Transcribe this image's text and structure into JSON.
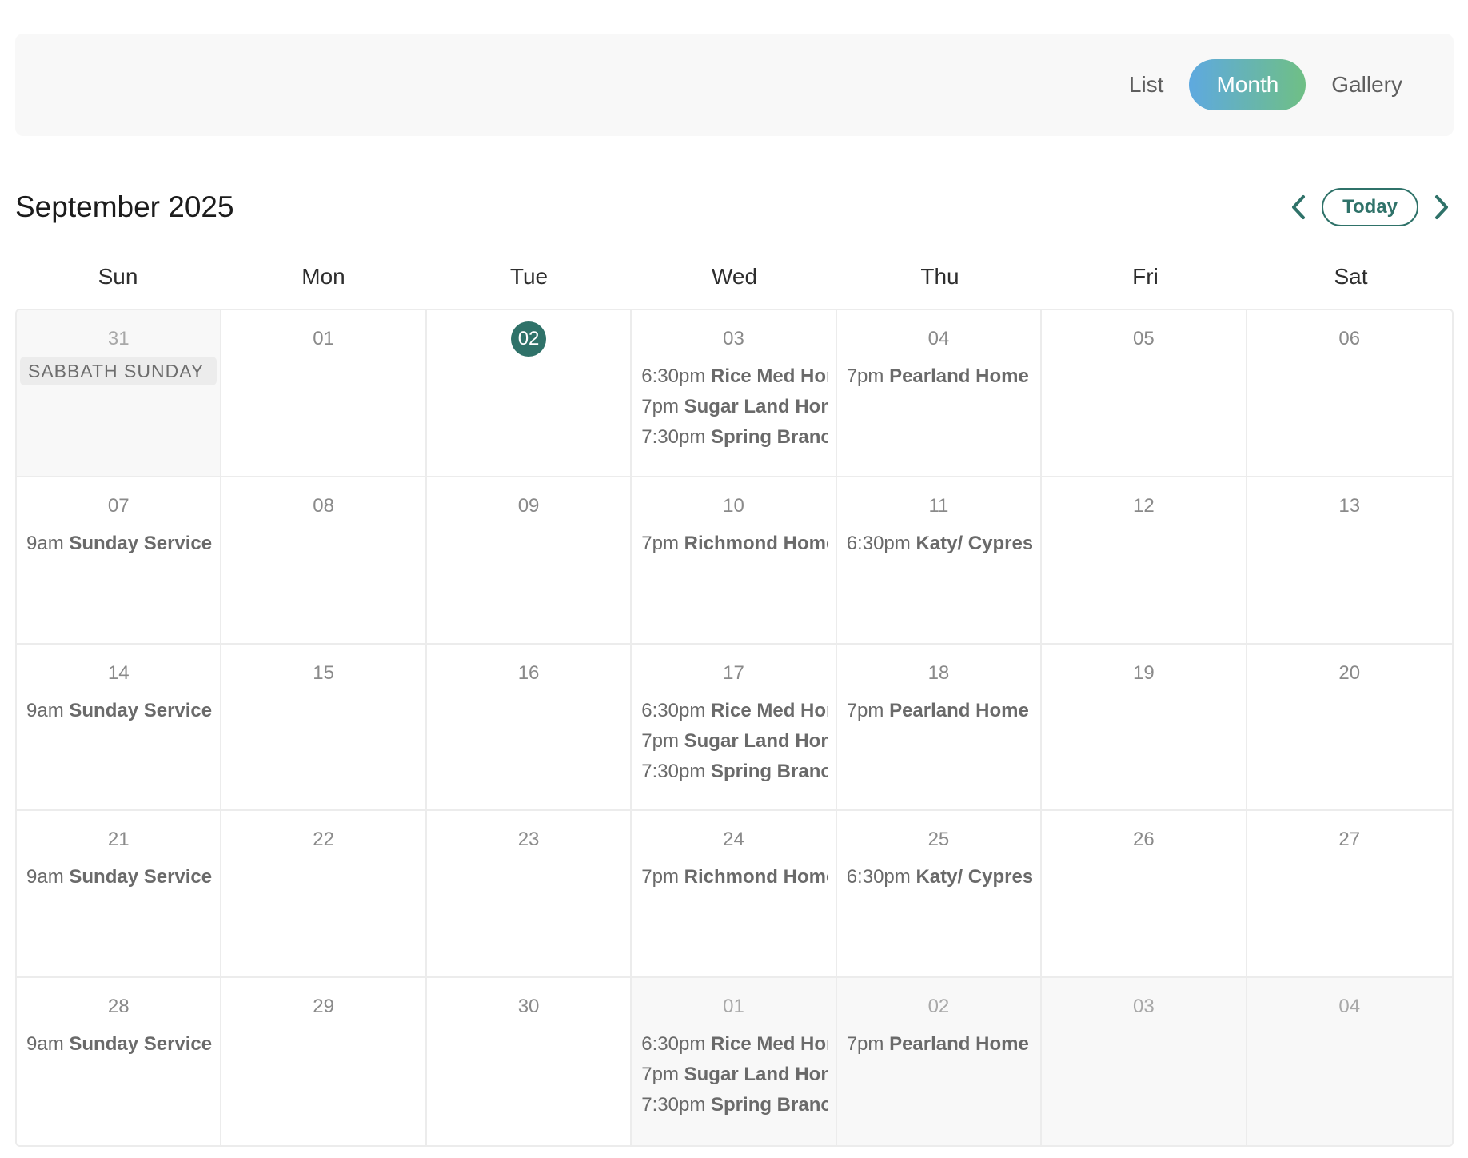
{
  "view_switch": {
    "list": "List",
    "month": "Month",
    "gallery": "Gallery",
    "active": "Month"
  },
  "header": {
    "title": "September 2025",
    "today": "Today",
    "prev_icon": "chevron-left-icon",
    "next_icon": "chevron-right-icon"
  },
  "colors": {
    "accent": "#2f7269",
    "gradient_start": "#5ea9e0",
    "gradient_end": "#6fbf85"
  },
  "weekdays": [
    "Sun",
    "Mon",
    "Tue",
    "Wed",
    "Thu",
    "Fri",
    "Sat"
  ],
  "weeks": [
    [
      {
        "day": "31",
        "muted": true,
        "all_day": "SABBATH SUNDAY",
        "events": []
      },
      {
        "day": "01",
        "events": []
      },
      {
        "day": "02",
        "today": true,
        "events": []
      },
      {
        "day": "03",
        "events": [
          {
            "time": "6:30pm",
            "title": "Rice Med Home Group"
          },
          {
            "time": "7pm",
            "title": "Sugar Land Home Group"
          },
          {
            "time": "7:30pm",
            "title": "Spring Branch Home Group"
          }
        ]
      },
      {
        "day": "04",
        "events": [
          {
            "time": "7pm",
            "title": "Pearland Home Group"
          }
        ]
      },
      {
        "day": "05",
        "events": []
      },
      {
        "day": "06",
        "events": []
      }
    ],
    [
      {
        "day": "07",
        "events": [
          {
            "time": "9am",
            "title": "Sunday Service"
          }
        ]
      },
      {
        "day": "08",
        "events": []
      },
      {
        "day": "09",
        "events": []
      },
      {
        "day": "10",
        "events": [
          {
            "time": "7pm",
            "title": "Richmond Home Group"
          }
        ]
      },
      {
        "day": "11",
        "events": [
          {
            "time": "6:30pm",
            "title": "Katy/ Cypress Home Group"
          }
        ]
      },
      {
        "day": "12",
        "events": []
      },
      {
        "day": "13",
        "events": []
      }
    ],
    [
      {
        "day": "14",
        "events": [
          {
            "time": "9am",
            "title": "Sunday Service"
          }
        ]
      },
      {
        "day": "15",
        "events": []
      },
      {
        "day": "16",
        "events": []
      },
      {
        "day": "17",
        "events": [
          {
            "time": "6:30pm",
            "title": "Rice Med Home Group"
          },
          {
            "time": "7pm",
            "title": "Sugar Land Home Group"
          },
          {
            "time": "7:30pm",
            "title": "Spring Branch Home Group"
          }
        ]
      },
      {
        "day": "18",
        "events": [
          {
            "time": "7pm",
            "title": "Pearland Home Group"
          }
        ]
      },
      {
        "day": "19",
        "events": []
      },
      {
        "day": "20",
        "events": []
      }
    ],
    [
      {
        "day": "21",
        "events": [
          {
            "time": "9am",
            "title": "Sunday Service"
          }
        ]
      },
      {
        "day": "22",
        "events": []
      },
      {
        "day": "23",
        "events": []
      },
      {
        "day": "24",
        "events": [
          {
            "time": "7pm",
            "title": "Richmond Home Group"
          }
        ]
      },
      {
        "day": "25",
        "events": [
          {
            "time": "6:30pm",
            "title": "Katy/ Cypress Home Group"
          }
        ]
      },
      {
        "day": "26",
        "events": []
      },
      {
        "day": "27",
        "events": []
      }
    ],
    [
      {
        "day": "28",
        "events": [
          {
            "time": "9am",
            "title": "Sunday Service"
          }
        ]
      },
      {
        "day": "29",
        "events": []
      },
      {
        "day": "30",
        "events": []
      },
      {
        "day": "01",
        "muted": true,
        "events": [
          {
            "time": "6:30pm",
            "title": "Rice Med Home Group"
          },
          {
            "time": "7pm",
            "title": "Sugar Land Home Group"
          },
          {
            "time": "7:30pm",
            "title": "Spring Branch Home Group"
          }
        ]
      },
      {
        "day": "02",
        "muted": true,
        "events": [
          {
            "time": "7pm",
            "title": "Pearland Home Group"
          }
        ]
      },
      {
        "day": "03",
        "muted": true,
        "events": []
      },
      {
        "day": "04",
        "muted": true,
        "events": []
      }
    ]
  ]
}
